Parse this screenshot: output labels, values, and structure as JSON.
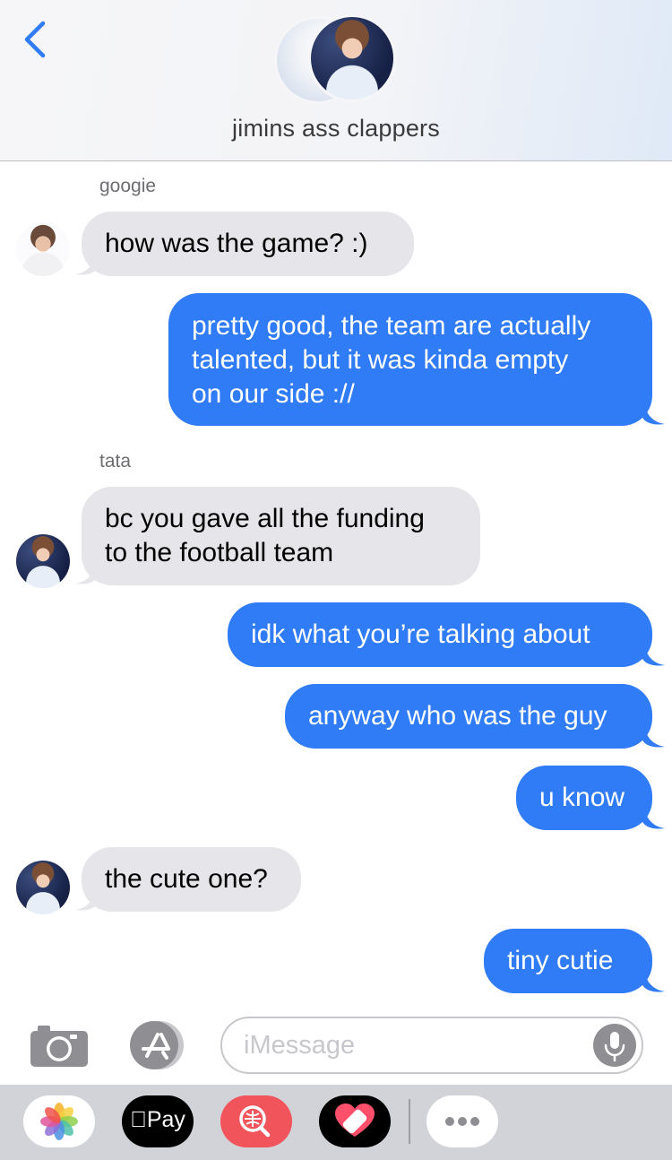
{
  "header": {
    "title": "jimins ass clappers"
  },
  "messages": [
    {
      "sender": "googie"
    },
    {
      "text": "how was the game? :)"
    },
    {
      "line1": "pretty good, the team are actually",
      "line2": "talented, but it was kinda empty",
      "line3": "on our side ://"
    },
    {
      "sender": "tata"
    },
    {
      "line1": "bc you gave all the funding",
      "line2": "to the football team"
    },
    {
      "text": "idk what you’re talking about"
    },
    {
      "text": "anyway who was the guy"
    },
    {
      "text": "u know"
    },
    {
      "text": "the cute one?"
    },
    {
      "text": "tiny cutie"
    }
  ],
  "input": {
    "placeholder": "iMessage"
  },
  "apps": {
    "pay_label": "Pay"
  },
  "colors": {
    "outgoing_bubble": "#2f7cf6",
    "incoming_bubble": "#e5e5ea",
    "ios_blue": "#2f7cf6"
  },
  "icons": [
    "back-chevron-icon",
    "camera-icon",
    "app-store-icon",
    "microphone-icon",
    "photos-icon",
    "apple-icon",
    "search-images-icon",
    "heart-bandage-icon",
    "more-icon"
  ]
}
